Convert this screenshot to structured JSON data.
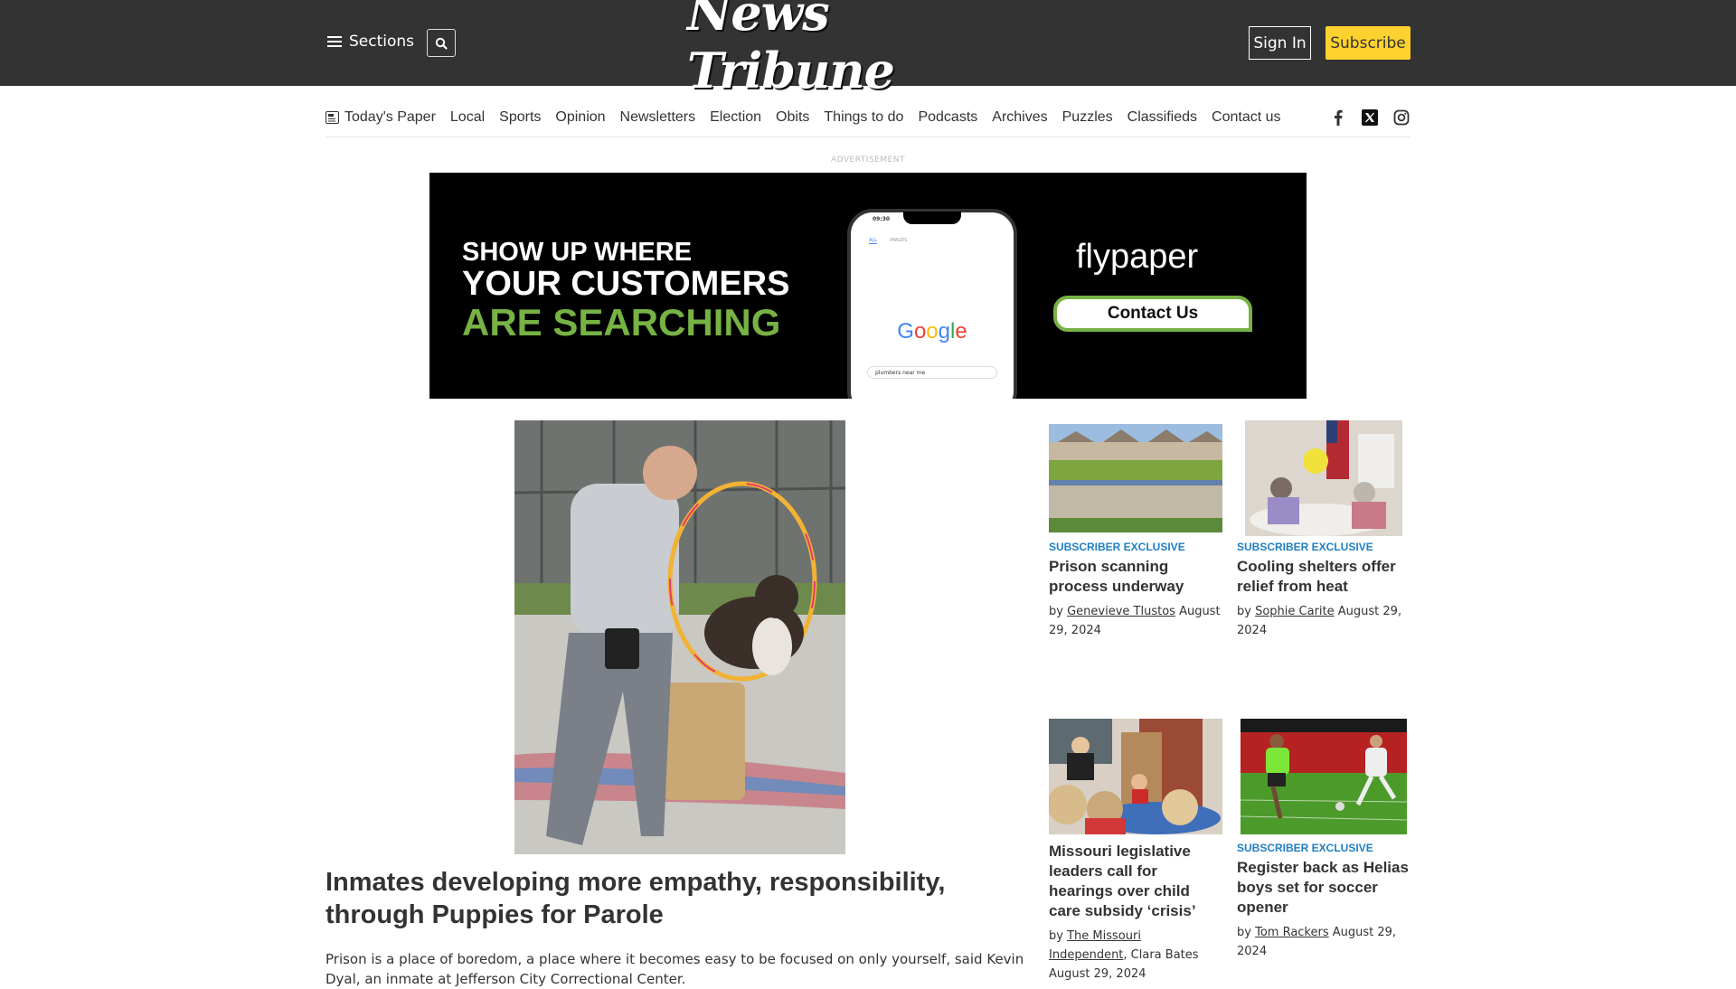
{
  "header": {
    "sections_label": "Sections",
    "logo_text": "News Tribune",
    "signin_label": "Sign In",
    "subscribe_label": "Subscribe",
    "subscribe_color": "#fdd22e",
    "background_color": "#333333"
  },
  "nav": {
    "items": [
      "Today's Paper",
      "Local",
      "Sports",
      "Opinion",
      "Newsletters",
      "Election",
      "Obits",
      "Things to do",
      "Podcasts",
      "Archives",
      "Puzzles",
      "Classifieds",
      "Contact us"
    ],
    "social": [
      "facebook",
      "x",
      "instagram"
    ]
  },
  "ad": {
    "label": "ADVERTISEMENT",
    "line1": "SHOW UP WHERE",
    "line2": "YOUR CUSTOMERS",
    "line3": "ARE SEARCHING",
    "phone_time": "09:30",
    "phone_tab_all": "ALL",
    "phone_tab_images": "IMAGES",
    "phone_logo": "Google",
    "phone_search": "plumbers near me",
    "brand": "flypaper",
    "cta": "Contact Us",
    "accent_color": "#77b244"
  },
  "lead": {
    "title": "Inmates developing more empathy, responsibility, through Puppies for Parole",
    "excerpt": "Prison is a place of boredom, a place where it becomes easy to be focused on only yourself, said Kevin Dyal, an inmate at Jefferson City Correctional Center."
  },
  "cards": [
    {
      "kicker": "SUBSCRIBER EXCLUSIVE",
      "title": "Prison scanning process underway",
      "by": "by",
      "author": "Genevieve Tlustos",
      "extra": "",
      "date": "August 29, 2024"
    },
    {
      "kicker": "SUBSCRIBER EXCLUSIVE",
      "title": "Cooling shelters offer relief from heat",
      "by": "by",
      "author": "Sophie Carite",
      "extra": "",
      "date": "August 29, 2024"
    },
    {
      "kicker": "",
      "title": "Missouri legislative leaders call for hearings over child care subsidy ‘crisis’",
      "by": "by",
      "author": "The Missouri Independent",
      "extra": ", Clara Bates",
      "date": "August 29, 2024"
    },
    {
      "kicker": "SUBSCRIBER EXCLUSIVE",
      "title": "Register back as Helias boys set for soccer opener",
      "by": "by",
      "author": "Tom Rackers",
      "extra": "",
      "date": "August 29, 2024"
    }
  ],
  "kicker_color": "#1f7fc4"
}
